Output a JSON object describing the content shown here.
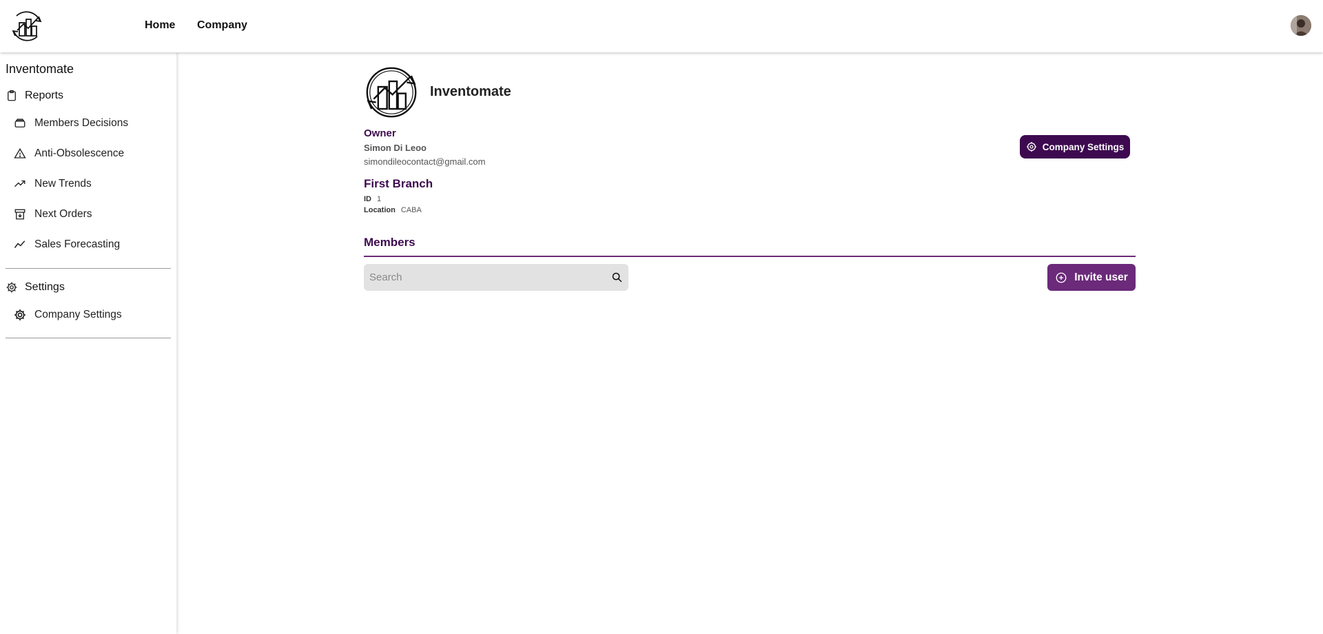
{
  "header": {
    "nav": [
      {
        "label": "Home"
      },
      {
        "label": "Company"
      }
    ]
  },
  "sidebar": {
    "title": "Inventomate",
    "reports_label": "Reports",
    "report_items": [
      {
        "label": "Members Decisions",
        "icon": "layers-icon"
      },
      {
        "label": "Anti-Obsolescence",
        "icon": "warning-icon"
      },
      {
        "label": "New Trends",
        "icon": "trending-up-icon"
      },
      {
        "label": "Next Orders",
        "icon": "archive-download-icon"
      },
      {
        "label": "Sales Forecasting",
        "icon": "line-chart-icon"
      }
    ],
    "settings_label": "Settings",
    "settings_items": [
      {
        "label": "Company Settings",
        "icon": "gear-icon"
      }
    ]
  },
  "company": {
    "name": "Inventomate",
    "owner_label": "Owner",
    "owner_name": "Simon Di Leoo",
    "owner_email": "simondileocontact@gmail.com",
    "settings_button": "Company Settings"
  },
  "branch": {
    "title": "First Branch",
    "id_label": "ID",
    "id_value": "1",
    "location_label": "Location",
    "location_value": "CABA"
  },
  "members": {
    "title": "Members",
    "search_placeholder": "Search",
    "invite_button": "Invite user"
  },
  "colors": {
    "primary_dark": "#3e0a4f",
    "primary": "#6b2a7a",
    "search_bg": "#e2e2e2"
  }
}
